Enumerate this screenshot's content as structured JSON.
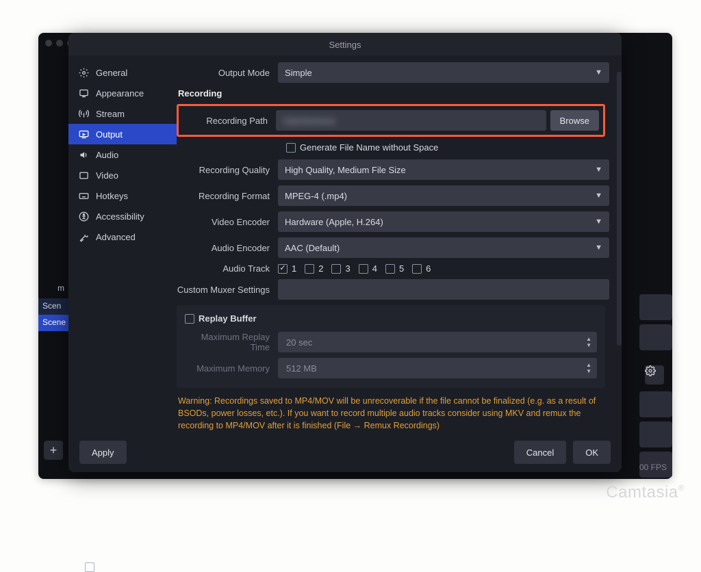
{
  "watermark": "Camtasia",
  "dialog_title": "Settings",
  "background": {
    "scene_label": "Scen",
    "scene_active": "Scene",
    "monitor_label": "m",
    "plus": "+",
    "fps": "00 FPS"
  },
  "sidebar": {
    "items": [
      {
        "key": "general",
        "label": "General"
      },
      {
        "key": "appearance",
        "label": "Appearance"
      },
      {
        "key": "stream",
        "label": "Stream"
      },
      {
        "key": "output",
        "label": "Output"
      },
      {
        "key": "audio",
        "label": "Audio"
      },
      {
        "key": "video",
        "label": "Video"
      },
      {
        "key": "hotkeys",
        "label": "Hotkeys"
      },
      {
        "key": "accessibility",
        "label": "Accessibility"
      },
      {
        "key": "advanced",
        "label": "Advanced"
      }
    ],
    "selected": "output"
  },
  "output": {
    "mode_label": "Output Mode",
    "mode_value": "Simple",
    "recording_section": "Recording",
    "path_label": "Recording Path",
    "path_value_obscured": "Users/xxxxxx",
    "browse": "Browse",
    "gen_filename": "Generate File Name without Space",
    "quality_label": "Recording Quality",
    "quality_value": "High Quality, Medium File Size",
    "format_label": "Recording Format",
    "format_value": "MPEG-4 (.mp4)",
    "venc_label": "Video Encoder",
    "venc_value": "Hardware (Apple, H.264)",
    "aenc_label": "Audio Encoder",
    "aenc_value": "AAC (Default)",
    "track_label": "Audio Track",
    "tracks": [
      "1",
      "2",
      "3",
      "4",
      "5",
      "6"
    ],
    "muxer_label": "Custom Muxer Settings",
    "replay_title": "Replay Buffer",
    "replay_time_label": "Maximum Replay Time",
    "replay_time_value": "20 sec",
    "replay_mem_label": "Maximum Memory",
    "replay_mem_value": "512 MB",
    "warning": "Warning: Recordings saved to MP4/MOV will be unrecoverable if the file cannot be finalized (e.g. as a result of BSODs, power losses, etc.). If you want to record multiple audio tracks consider using MKV and remux the recording to MP4/MOV after it is finished (File → Remux Recordings)"
  },
  "footer": {
    "apply": "Apply",
    "cancel": "Cancel",
    "ok": "OK"
  }
}
